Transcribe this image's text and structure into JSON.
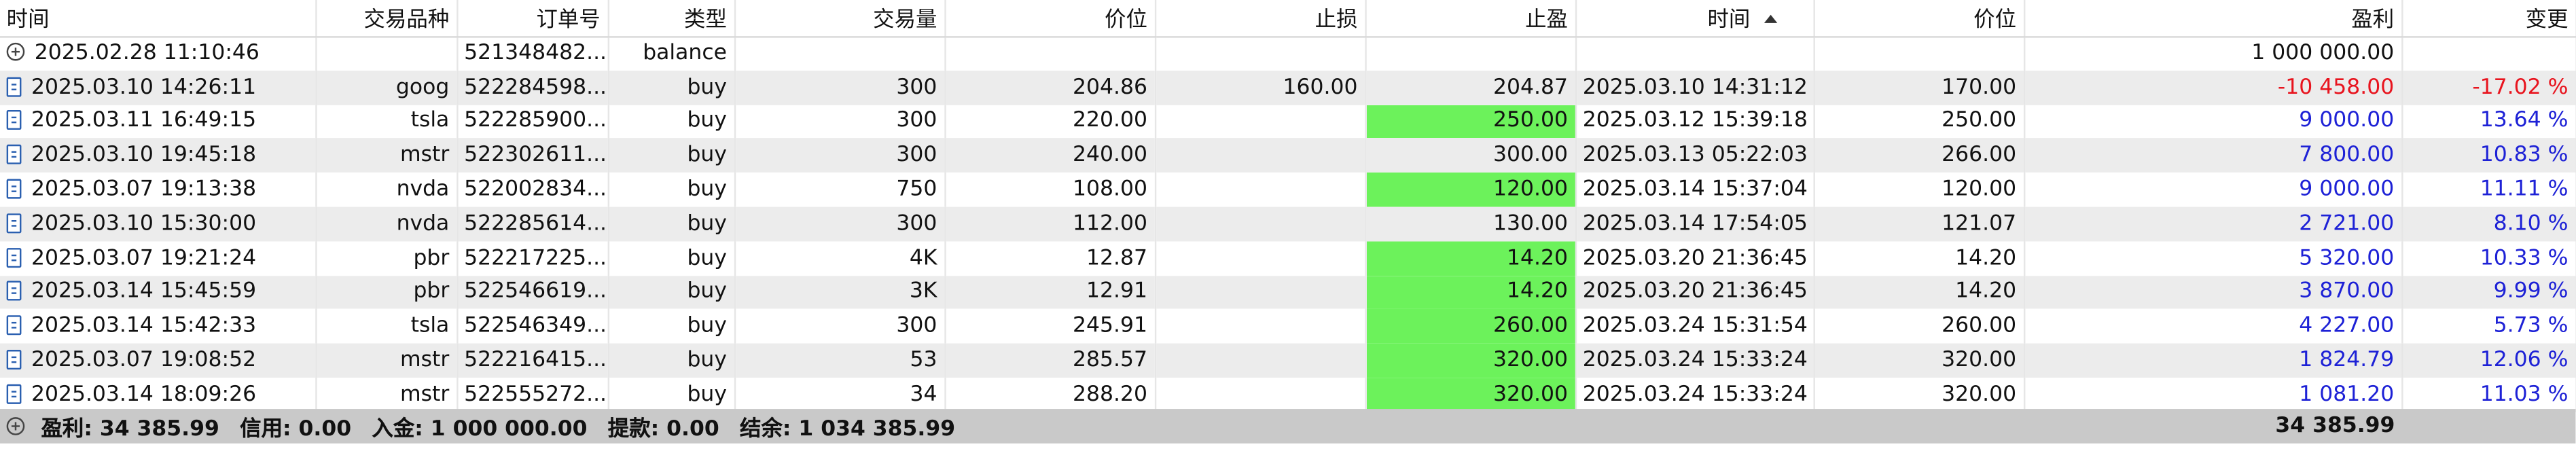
{
  "columns": [
    "时间",
    "交易品种",
    "订单号",
    "类型",
    "交易量",
    "价位",
    "止损",
    "止盈",
    "时间",
    "价位",
    "盈利",
    "变更"
  ],
  "rows": [
    {
      "open_time": "2025.02.28 11:10:46",
      "symbol": "",
      "order": "521348482...",
      "type": "balance",
      "volume": "",
      "price": "",
      "sl": "",
      "tp": "",
      "close_time": "",
      "close_price": "",
      "profit": "1 000 000.00",
      "change": "",
      "tp_hit": false,
      "sign": "none",
      "icon": "plus-icon"
    },
    {
      "open_time": "2025.03.10 14:26:11",
      "symbol": "goog",
      "order": "522284598...",
      "type": "buy",
      "volume": "300",
      "price": "204.86",
      "sl": "160.00",
      "tp": "204.87",
      "close_time": "2025.03.10 14:31:12",
      "close_price": "170.00",
      "profit": "-10 458.00",
      "change": "-17.02 %",
      "tp_hit": false,
      "sign": "neg",
      "icon": "doc-icon"
    },
    {
      "open_time": "2025.03.11 16:49:15",
      "symbol": "tsla",
      "order": "522285900...",
      "type": "buy",
      "volume": "300",
      "price": "220.00",
      "sl": "",
      "tp": "250.00",
      "close_time": "2025.03.12 15:39:18",
      "close_price": "250.00",
      "profit": "9 000.00",
      "change": "13.64 %",
      "tp_hit": true,
      "sign": "pos",
      "icon": "doc-icon"
    },
    {
      "open_time": "2025.03.10 19:45:18",
      "symbol": "mstr",
      "order": "522302611...",
      "type": "buy",
      "volume": "300",
      "price": "240.00",
      "sl": "",
      "tp": "300.00",
      "close_time": "2025.03.13 05:22:03",
      "close_price": "266.00",
      "profit": "7 800.00",
      "change": "10.83 %",
      "tp_hit": false,
      "sign": "pos",
      "icon": "doc-icon"
    },
    {
      "open_time": "2025.03.07 19:13:38",
      "symbol": "nvda",
      "order": "522002834...",
      "type": "buy",
      "volume": "750",
      "price": "108.00",
      "sl": "",
      "tp": "120.00",
      "close_time": "2025.03.14 15:37:04",
      "close_price": "120.00",
      "profit": "9 000.00",
      "change": "11.11 %",
      "tp_hit": true,
      "sign": "pos",
      "icon": "doc-icon"
    },
    {
      "open_time": "2025.03.10 15:30:00",
      "symbol": "nvda",
      "order": "522285614...",
      "type": "buy",
      "volume": "300",
      "price": "112.00",
      "sl": "",
      "tp": "130.00",
      "close_time": "2025.03.14 17:54:05",
      "close_price": "121.07",
      "profit": "2 721.00",
      "change": "8.10 %",
      "tp_hit": false,
      "sign": "pos",
      "icon": "doc-icon"
    },
    {
      "open_time": "2025.03.07 19:21:24",
      "symbol": "pbr",
      "order": "522217225...",
      "type": "buy",
      "volume": "4K",
      "price": "12.87",
      "sl": "",
      "tp": "14.20",
      "close_time": "2025.03.20 21:36:45",
      "close_price": "14.20",
      "profit": "5 320.00",
      "change": "10.33 %",
      "tp_hit": true,
      "sign": "pos",
      "icon": "doc-icon"
    },
    {
      "open_time": "2025.03.14 15:45:59",
      "symbol": "pbr",
      "order": "522546619...",
      "type": "buy",
      "volume": "3K",
      "price": "12.91",
      "sl": "",
      "tp": "14.20",
      "close_time": "2025.03.20 21:36:45",
      "close_price": "14.20",
      "profit": "3 870.00",
      "change": "9.99 %",
      "tp_hit": true,
      "sign": "pos",
      "icon": "doc-icon"
    },
    {
      "open_time": "2025.03.14 15:42:33",
      "symbol": "tsla",
      "order": "522546349...",
      "type": "buy",
      "volume": "300",
      "price": "245.91",
      "sl": "",
      "tp": "260.00",
      "close_time": "2025.03.24 15:31:54",
      "close_price": "260.00",
      "profit": "4 227.00",
      "change": "5.73 %",
      "tp_hit": true,
      "sign": "pos",
      "icon": "doc-icon"
    },
    {
      "open_time": "2025.03.07 19:08:52",
      "symbol": "mstr",
      "order": "522216415...",
      "type": "buy",
      "volume": "53",
      "price": "285.57",
      "sl": "",
      "tp": "320.00",
      "close_time": "2025.03.24 15:33:24",
      "close_price": "320.00",
      "profit": "1 824.79",
      "change": "12.06 %",
      "tp_hit": true,
      "sign": "pos",
      "icon": "doc-icon"
    },
    {
      "open_time": "2025.03.14 18:09:26",
      "symbol": "mstr",
      "order": "522555272...",
      "type": "buy",
      "volume": "34",
      "price": "288.20",
      "sl": "",
      "tp": "320.00",
      "close_time": "2025.03.24 15:33:24",
      "close_price": "320.00",
      "profit": "1 081.20",
      "change": "11.03 %",
      "tp_hit": true,
      "sign": "pos",
      "icon": "doc-icon"
    }
  ],
  "footer": {
    "profit": "盈利: 34 385.99",
    "credit": "信用: 0.00",
    "deposit": "入金: 1 000 000.00",
    "withdrawal": "提款: 0.00",
    "balance": "结余: 1 034 385.99",
    "total": "34 385.99"
  },
  "colors": {
    "tp_hit": "#6cf25b",
    "negative": "#e8141e",
    "positive": "#1d21d6",
    "row_alt": "#ececec",
    "footer_bg": "#c9c9c9"
  },
  "sort": {
    "column_index": 8,
    "direction": "ascending"
  }
}
